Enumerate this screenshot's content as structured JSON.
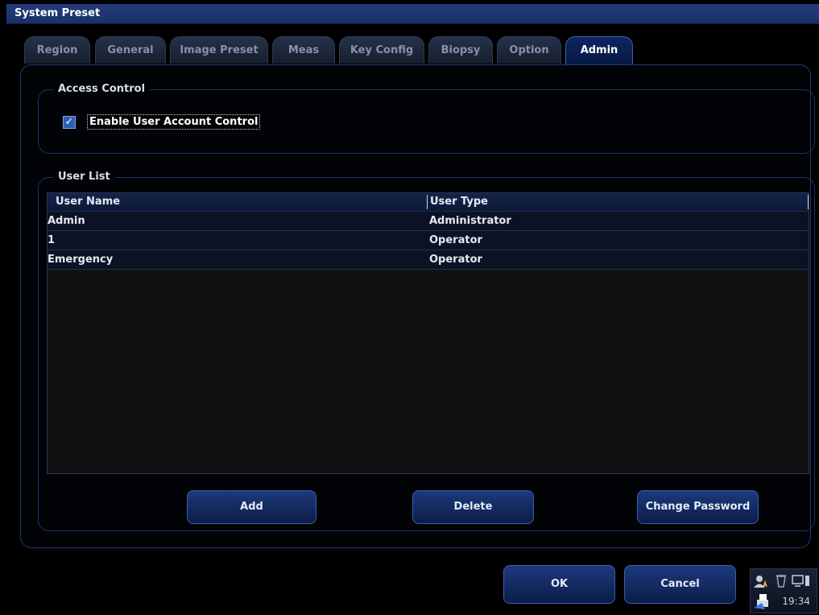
{
  "window": {
    "title": "System Preset"
  },
  "tabs": [
    {
      "label": "Region",
      "active": false
    },
    {
      "label": "General",
      "active": false
    },
    {
      "label": "Image Preset",
      "active": false
    },
    {
      "label": "Meas",
      "active": false
    },
    {
      "label": "Key Config",
      "active": false
    },
    {
      "label": "Biopsy",
      "active": false
    },
    {
      "label": "Option",
      "active": false
    },
    {
      "label": "Admin",
      "active": true
    }
  ],
  "access_control": {
    "title": "Access Control",
    "enable_uac_label": "Enable User Account Control",
    "enable_uac_checked": true
  },
  "user_list": {
    "title": "User List",
    "columns": [
      "User Name",
      "User Type"
    ],
    "rows": [
      {
        "name": "Admin",
        "type": "Administrator"
      },
      {
        "name": "1",
        "type": "Operator"
      },
      {
        "name": "Emergency",
        "type": "Operator"
      }
    ],
    "add_label": "Add",
    "delete_label": "Delete",
    "change_password_label": "Change Password"
  },
  "dialog": {
    "ok_label": "OK",
    "cancel_label": "Cancel"
  },
  "tray": {
    "time": "19:34",
    "icons": [
      "user-icon",
      "recycle-bin-icon",
      "monitor-icon",
      "printer-icon"
    ]
  },
  "colors": {
    "accent": "#1d3a7c",
    "title_bar": "#243c7c",
    "check": "#2e5fb8"
  }
}
